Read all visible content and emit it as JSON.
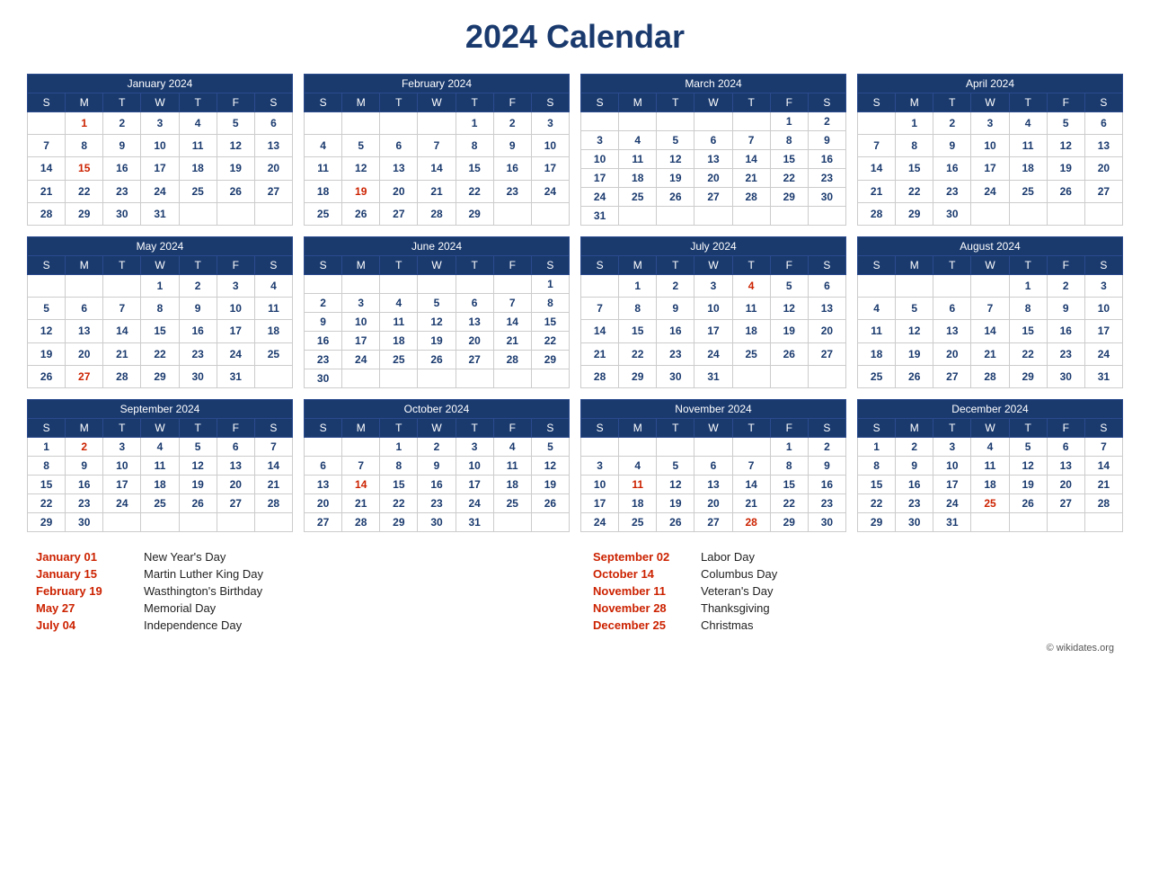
{
  "title": "2024 Calendar",
  "months": [
    {
      "name": "January 2024",
      "days": [
        [
          "",
          "1",
          "2",
          "3",
          "4",
          "5",
          "6"
        ],
        [
          "7",
          "8",
          "9",
          "10",
          "11",
          "12",
          "13"
        ],
        [
          "14",
          "15",
          "16",
          "17",
          "18",
          "19",
          "20"
        ],
        [
          "21",
          "22",
          "23",
          "24",
          "25",
          "26",
          "27"
        ],
        [
          "28",
          "29",
          "30",
          "31",
          "",
          "",
          ""
        ]
      ],
      "holidays": [
        "1",
        "15"
      ]
    },
    {
      "name": "February 2024",
      "days": [
        [
          "",
          "",
          "",
          "",
          "1",
          "2",
          "3"
        ],
        [
          "4",
          "5",
          "6",
          "7",
          "8",
          "9",
          "10"
        ],
        [
          "11",
          "12",
          "13",
          "14",
          "15",
          "16",
          "17"
        ],
        [
          "18",
          "19",
          "20",
          "21",
          "22",
          "23",
          "24"
        ],
        [
          "25",
          "26",
          "27",
          "28",
          "29",
          "",
          ""
        ]
      ],
      "holidays": [
        "19"
      ]
    },
    {
      "name": "March 2024",
      "days": [
        [
          "",
          "",
          "",
          "",
          "",
          "1",
          "2"
        ],
        [
          "3",
          "4",
          "5",
          "6",
          "7",
          "8",
          "9"
        ],
        [
          "10",
          "11",
          "12",
          "13",
          "14",
          "15",
          "16"
        ],
        [
          "17",
          "18",
          "19",
          "20",
          "21",
          "22",
          "23"
        ],
        [
          "24",
          "25",
          "26",
          "27",
          "28",
          "29",
          "30"
        ],
        [
          "31",
          "",
          "",
          "",
          "",
          "",
          ""
        ]
      ],
      "holidays": []
    },
    {
      "name": "April 2024",
      "days": [
        [
          "",
          "1",
          "2",
          "3",
          "4",
          "5",
          "6"
        ],
        [
          "7",
          "8",
          "9",
          "10",
          "11",
          "12",
          "13"
        ],
        [
          "14",
          "15",
          "16",
          "17",
          "18",
          "19",
          "20"
        ],
        [
          "21",
          "22",
          "23",
          "24",
          "25",
          "26",
          "27"
        ],
        [
          "28",
          "29",
          "30",
          "",
          "",
          "",
          ""
        ]
      ],
      "holidays": []
    },
    {
      "name": "May 2024",
      "days": [
        [
          "",
          "",
          "",
          "1",
          "2",
          "3",
          "4"
        ],
        [
          "5",
          "6",
          "7",
          "8",
          "9",
          "10",
          "11"
        ],
        [
          "12",
          "13",
          "14",
          "15",
          "16",
          "17",
          "18"
        ],
        [
          "19",
          "20",
          "21",
          "22",
          "23",
          "24",
          "25"
        ],
        [
          "26",
          "27",
          "28",
          "29",
          "30",
          "31",
          ""
        ]
      ],
      "holidays": [
        "27"
      ]
    },
    {
      "name": "June 2024",
      "days": [
        [
          "",
          "",
          "",
          "",
          "",
          "",
          "1"
        ],
        [
          "2",
          "3",
          "4",
          "5",
          "6",
          "7",
          "8"
        ],
        [
          "9",
          "10",
          "11",
          "12",
          "13",
          "14",
          "15"
        ],
        [
          "16",
          "17",
          "18",
          "19",
          "20",
          "21",
          "22"
        ],
        [
          "23",
          "24",
          "25",
          "26",
          "27",
          "28",
          "29"
        ],
        [
          "30",
          "",
          "",
          "",
          "",
          "",
          ""
        ]
      ],
      "holidays": []
    },
    {
      "name": "July 2024",
      "days": [
        [
          "",
          "1",
          "2",
          "3",
          "4",
          "5",
          "6"
        ],
        [
          "7",
          "8",
          "9",
          "10",
          "11",
          "12",
          "13"
        ],
        [
          "14",
          "15",
          "16",
          "17",
          "18",
          "19",
          "20"
        ],
        [
          "21",
          "22",
          "23",
          "24",
          "25",
          "26",
          "27"
        ],
        [
          "28",
          "29",
          "30",
          "31",
          "",
          "",
          ""
        ]
      ],
      "holidays": [
        "4"
      ]
    },
    {
      "name": "August 2024",
      "days": [
        [
          "",
          "",
          "",
          "",
          "1",
          "2",
          "3"
        ],
        [
          "4",
          "5",
          "6",
          "7",
          "8",
          "9",
          "10"
        ],
        [
          "11",
          "12",
          "13",
          "14",
          "15",
          "16",
          "17"
        ],
        [
          "18",
          "19",
          "20",
          "21",
          "22",
          "23",
          "24"
        ],
        [
          "25",
          "26",
          "27",
          "28",
          "29",
          "30",
          "31"
        ]
      ],
      "holidays": []
    },
    {
      "name": "September 2024",
      "days": [
        [
          "1",
          "2",
          "3",
          "4",
          "5",
          "6",
          "7"
        ],
        [
          "8",
          "9",
          "10",
          "11",
          "12",
          "13",
          "14"
        ],
        [
          "15",
          "16",
          "17",
          "18",
          "19",
          "20",
          "21"
        ],
        [
          "22",
          "23",
          "24",
          "25",
          "26",
          "27",
          "28"
        ],
        [
          "29",
          "30",
          "",
          "",
          "",
          "",
          ""
        ]
      ],
      "holidays": [
        "2"
      ]
    },
    {
      "name": "October 2024",
      "days": [
        [
          "",
          "",
          "1",
          "2",
          "3",
          "4",
          "5"
        ],
        [
          "6",
          "7",
          "8",
          "9",
          "10",
          "11",
          "12"
        ],
        [
          "13",
          "14",
          "15",
          "16",
          "17",
          "18",
          "19"
        ],
        [
          "20",
          "21",
          "22",
          "23",
          "24",
          "25",
          "26"
        ],
        [
          "27",
          "28",
          "29",
          "30",
          "31",
          "",
          ""
        ]
      ],
      "holidays": [
        "14"
      ]
    },
    {
      "name": "November 2024",
      "days": [
        [
          "",
          "",
          "",
          "",
          "",
          "1",
          "2"
        ],
        [
          "3",
          "4",
          "5",
          "6",
          "7",
          "8",
          "9"
        ],
        [
          "10",
          "11",
          "12",
          "13",
          "14",
          "15",
          "16"
        ],
        [
          "17",
          "18",
          "19",
          "20",
          "21",
          "22",
          "23"
        ],
        [
          "24",
          "25",
          "26",
          "27",
          "28",
          "29",
          "30"
        ]
      ],
      "holidays": [
        "11",
        "28"
      ]
    },
    {
      "name": "December 2024",
      "days": [
        [
          "1",
          "2",
          "3",
          "4",
          "5",
          "6",
          "7"
        ],
        [
          "8",
          "9",
          "10",
          "11",
          "12",
          "13",
          "14"
        ],
        [
          "15",
          "16",
          "17",
          "18",
          "19",
          "20",
          "21"
        ],
        [
          "22",
          "23",
          "24",
          "25",
          "26",
          "27",
          "28"
        ],
        [
          "29",
          "30",
          "31",
          "",
          "",
          "",
          ""
        ]
      ],
      "holidays": [
        "25"
      ]
    }
  ],
  "day_headers": [
    "S",
    "M",
    "T",
    "W",
    "T",
    "F",
    "S"
  ],
  "holidays_left": [
    {
      "date": "January 01",
      "name": "New Year's Day"
    },
    {
      "date": "January 15",
      "name": "Martin Luther King Day"
    },
    {
      "date": "February 19",
      "name": "Wasthington's Birthday"
    },
    {
      "date": "May 27",
      "name": "Memorial Day"
    },
    {
      "date": "July 04",
      "name": "Independence Day"
    }
  ],
  "holidays_right": [
    {
      "date": "September 02",
      "name": "Labor Day"
    },
    {
      "date": "October 14",
      "name": "Columbus Day"
    },
    {
      "date": "November 11",
      "name": "Veteran's Day"
    },
    {
      "date": "November 28",
      "name": "Thanksgiving"
    },
    {
      "date": "December 25",
      "name": "Christmas"
    }
  ],
  "copyright": "© wikidates.org"
}
